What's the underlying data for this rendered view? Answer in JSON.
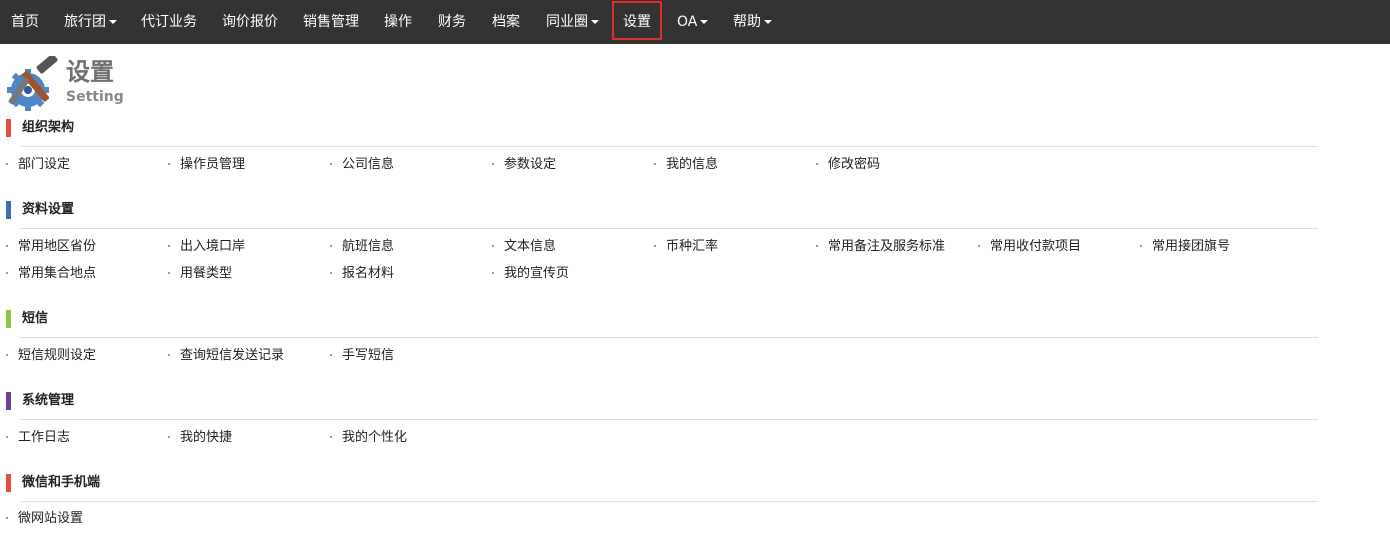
{
  "nav": {
    "items": [
      {
        "label": "首页",
        "dropdown": false
      },
      {
        "label": "旅行团",
        "dropdown": true
      },
      {
        "label": "代订业务",
        "dropdown": false
      },
      {
        "label": "询价报价",
        "dropdown": false
      },
      {
        "label": "销售管理",
        "dropdown": false
      },
      {
        "label": "操作",
        "dropdown": false
      },
      {
        "label": "财务",
        "dropdown": false
      },
      {
        "label": "档案",
        "dropdown": false
      },
      {
        "label": "同业圈",
        "dropdown": true
      },
      {
        "label": "设置",
        "dropdown": false,
        "active": true
      },
      {
        "label": "OA",
        "dropdown": true
      },
      {
        "label": "帮助",
        "dropdown": true
      }
    ]
  },
  "header": {
    "title": "设置",
    "subtitle": "Setting",
    "icon": "settings-tools-icon"
  },
  "sections": [
    {
      "title": "组织架构",
      "color": "#e84c3d",
      "links": [
        "部门设定",
        "操作员管理",
        "公司信息",
        "参数设定",
        "我的信息",
        "修改密码"
      ]
    },
    {
      "title": "资料设置",
      "color": "#3b6fb6",
      "links": [
        "常用地区省份",
        "出入境口岸",
        "航班信息",
        "文本信息",
        "币种汇率",
        "常用备注及服务标准",
        "常用收付款项目",
        "常用接团旗号",
        "常用集合地点",
        "用餐类型",
        "报名材料",
        "我的宣传页"
      ]
    },
    {
      "title": "短信",
      "color": "#8cc63f",
      "links": [
        "短信规则设定",
        "查询短信发送记录",
        "手写短信"
      ]
    },
    {
      "title": "系统管理",
      "color": "#6f3f9e",
      "links": [
        "工作日志",
        "我的快捷",
        "我的个性化"
      ]
    },
    {
      "title": "微信和手机端",
      "color": "#e84c3d",
      "links": [
        "微网站设置"
      ]
    }
  ],
  "colors": {
    "navbar_bg": "#333333",
    "highlight_border": "#e0302e"
  }
}
